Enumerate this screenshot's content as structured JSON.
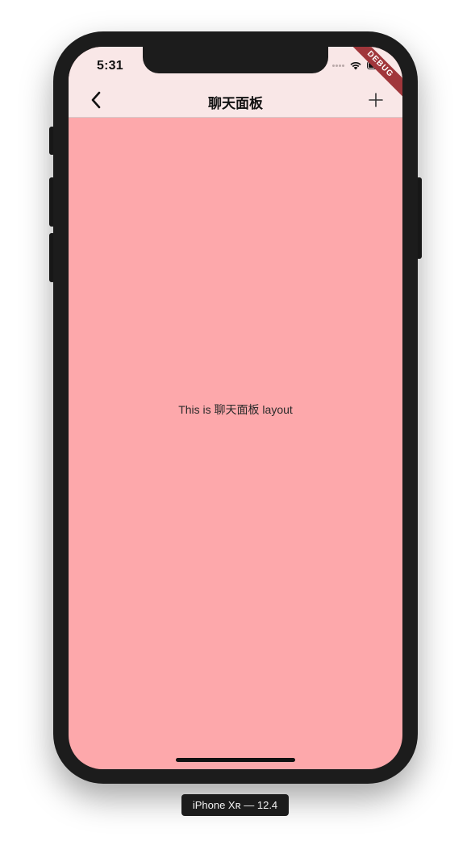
{
  "status_bar": {
    "time": "5:31",
    "icons": [
      "signal-dots-icon",
      "wifi-icon",
      "battery-icon"
    ]
  },
  "debug_banner": "DEBUG",
  "app_bar": {
    "back_icon": "chevron-left-icon",
    "title": "聊天面板",
    "action_icon": "plus-icon"
  },
  "body": {
    "text": "This is 聊天面板 layout"
  },
  "device_label": "iPhone Xʀ — 12.4",
  "colors": {
    "app_bar_bg": "#f9e7e7",
    "body_bg": "#fda8ab",
    "debug_banner": "#a0363b",
    "phone_frame": "#1c1c1c"
  }
}
